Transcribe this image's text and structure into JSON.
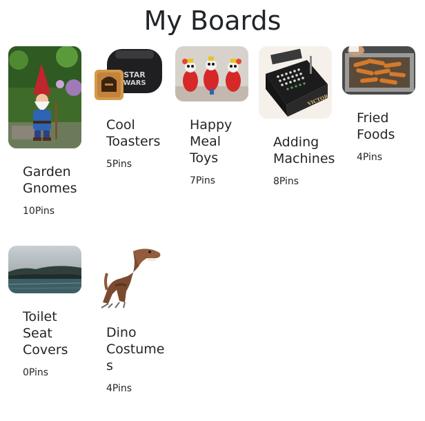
{
  "page": {
    "title": "My Boards"
  },
  "boards": [
    {
      "title": "Garden Gnomes",
      "pins": "10Pins",
      "image": "garden-gnome-image"
    },
    {
      "title": "Cool Toasters",
      "pins": "5Pins",
      "image": "star-wars-toaster-image"
    },
    {
      "title": "Happy Meal Toys",
      "pins": "7Pins",
      "image": "happy-meal-toys-image"
    },
    {
      "title": "Adding Machines",
      "pins": "8Pins",
      "image": "adding-machine-image"
    },
    {
      "title": "Fried Foods",
      "pins": "4Pins",
      "image": "fried-foods-image"
    },
    {
      "title": "Toilet Seat Covers",
      "pins": "0Pins",
      "image": "misty-lake-image"
    },
    {
      "title": "Dino Costumes",
      "pins": "4Pins",
      "image": "dinosaur-costume-image"
    }
  ],
  "colors": {
    "text": "#212529",
    "background": "#ffffff"
  }
}
